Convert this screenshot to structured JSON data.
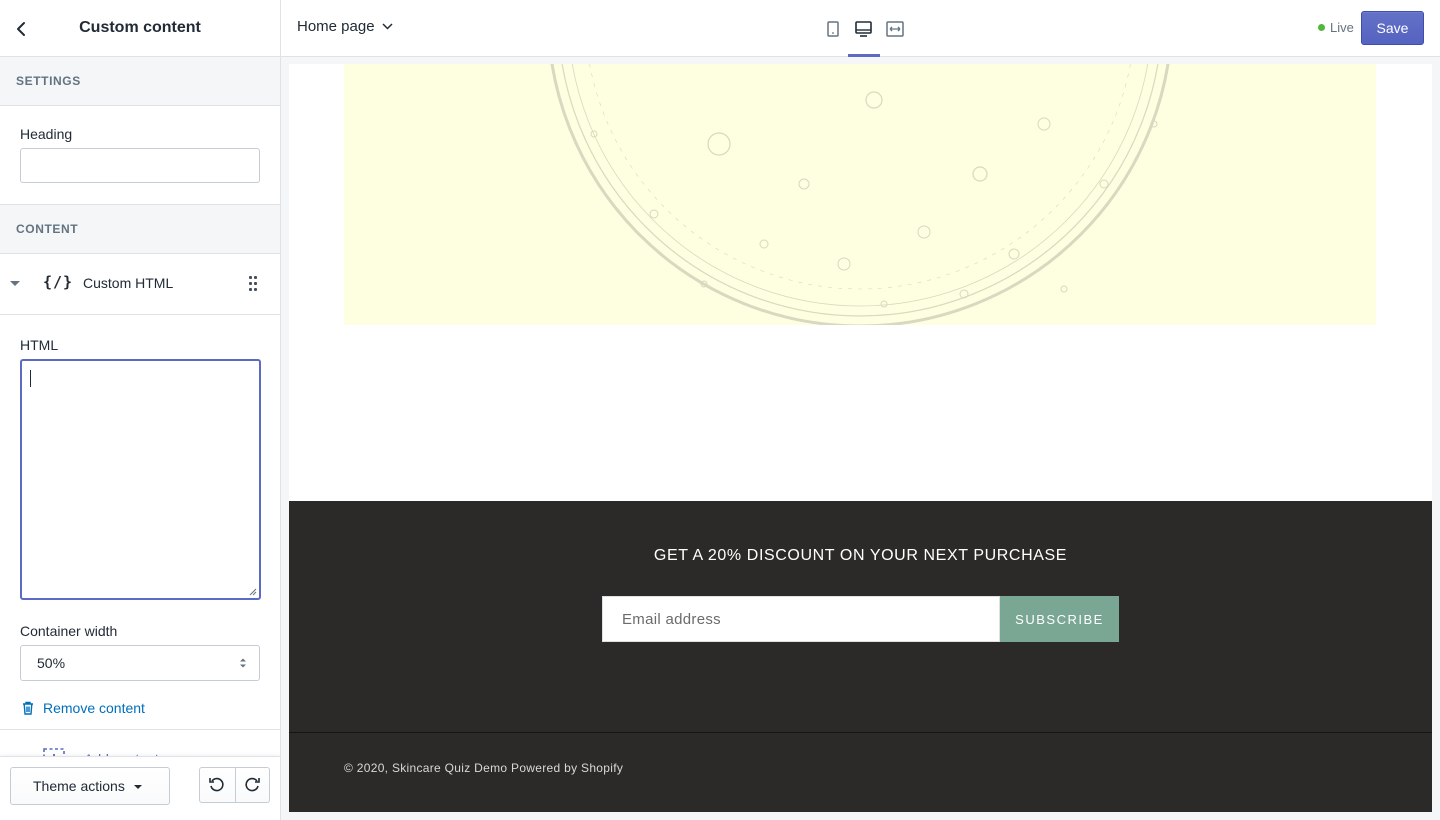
{
  "sidebar": {
    "title": "Custom content",
    "settings_heading": "SETTINGS",
    "heading_label": "Heading",
    "heading_value": "",
    "content_heading": "CONTENT",
    "block": {
      "icon": "code-icon",
      "icon_glyph": "{/}",
      "label": "Custom HTML"
    },
    "html_label": "HTML",
    "html_value": "",
    "container_width_label": "Container width",
    "container_width_value": "50%",
    "remove_label": "Remove content",
    "add_label": "Add content",
    "theme_actions_label": "Theme actions"
  },
  "topbar": {
    "page_selector": "Home page",
    "devices": [
      "mobile-icon",
      "desktop-icon",
      "fullwidth-icon"
    ],
    "active_device": "desktop-icon",
    "status": "Live",
    "save_label": "Save"
  },
  "preview": {
    "promo_text": "GET A 20% DISCOUNT ON YOUR NEXT PURCHASE",
    "email_placeholder": "Email address",
    "subscribe_label": "SUBSCRIBE",
    "copyright_text": "© 2020, Skincare Quiz Demo",
    "powered_by": "Powered by Shopify"
  },
  "colors": {
    "accent": "#5c6ac4",
    "link": "#006fbb",
    "live_dot": "#50b83c",
    "footer_bg": "#2b2a28",
    "subscribe_bg": "#7aa794",
    "hero_bg": "#fefee0"
  }
}
